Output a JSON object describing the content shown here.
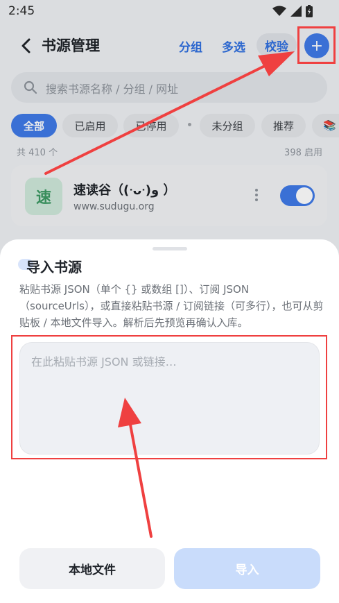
{
  "status_bar": {
    "time": "2:45",
    "icons": [
      "wifi-icon",
      "signal-icon",
      "battery-icon"
    ]
  },
  "app_bar": {
    "title": "书源管理",
    "group_label": "分组",
    "multi_select_label": "多选",
    "verify_label": "校验",
    "add_symbol": "+"
  },
  "search": {
    "placeholder": "搜索书源名称 / 分组 / 网址"
  },
  "filters": {
    "all": "全部",
    "enabled": "已启用",
    "disabled": "已停用",
    "ungrouped": "未分组",
    "recommended": "推荐",
    "books_emoji": "📚"
  },
  "counts": {
    "total": "共 410 个",
    "enabled": "398 启用"
  },
  "source_item": {
    "avatar_char": "速",
    "name": "速读谷（(ᐧᴗᐧ)و ）",
    "url": "www.sudugu.org",
    "enabled": true
  },
  "sheet": {
    "title": "导入书源",
    "description": "粘贴书源 JSON（单个 {} 或数组 []）、订阅 JSON（sourceUrls），或直接粘贴书源 / 订阅链接（可多行），也可从剪贴板 / 本地文件导入。解析后先预览再确认入库。",
    "input_placeholder": "在此粘贴书源 JSON 或链接…",
    "local_file_button": "本地文件",
    "import_button": "导入"
  },
  "colors": {
    "accent": "#3f7ae8",
    "annotation": "#ef4040",
    "import_disabled": "#c9dcfb"
  }
}
